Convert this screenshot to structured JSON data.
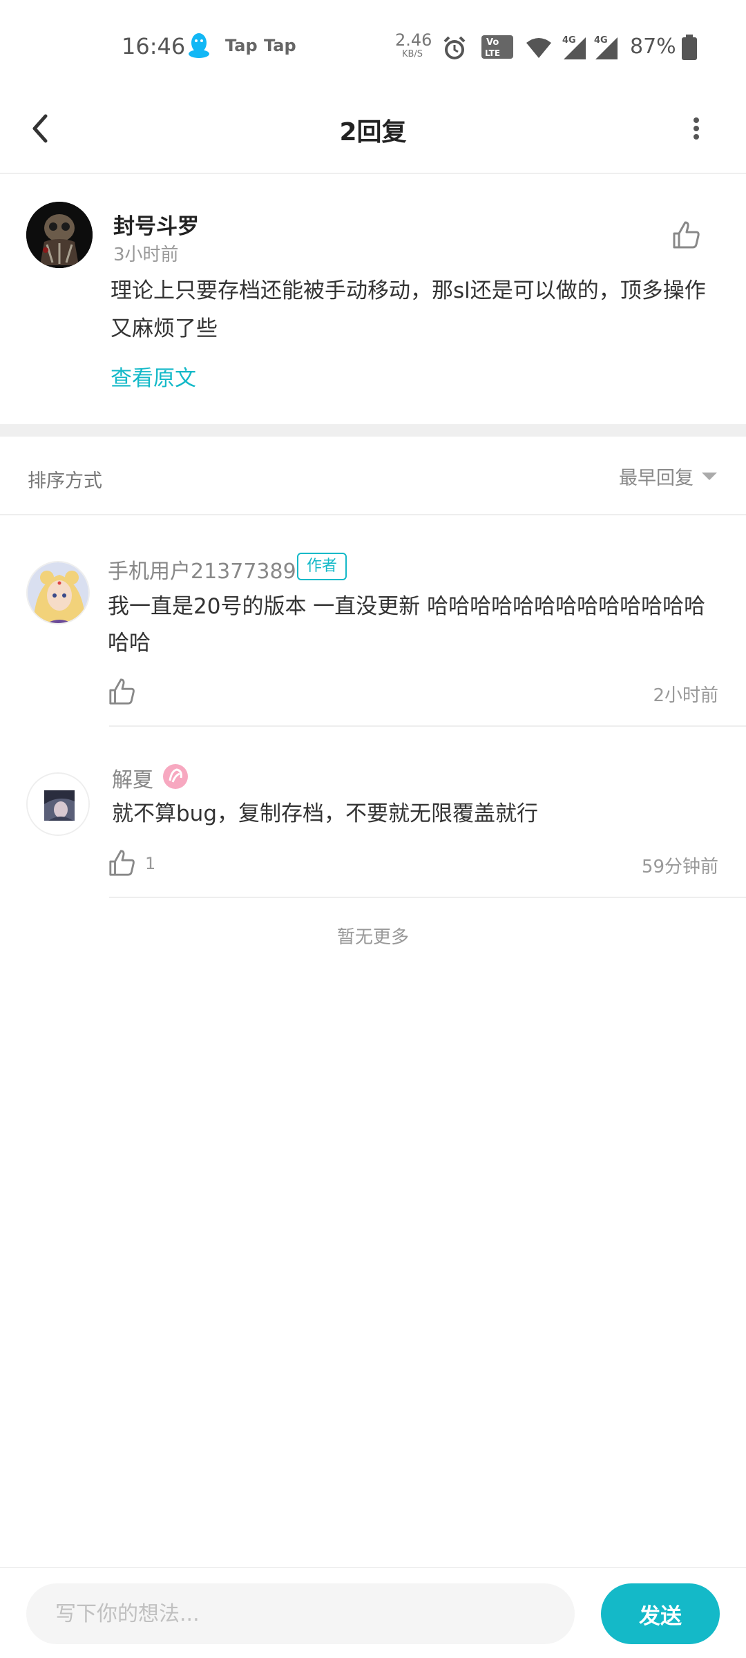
{
  "status_bar": {
    "time": "16:46",
    "app_1": "Tap",
    "app_2": "Tap",
    "net_speed": "2.46",
    "net_unit": "KB/S",
    "volte_top": "Vo",
    "volte_bottom": "LTE",
    "sig_label": "4G",
    "battery": "87%",
    "icons": [
      "qq-icon",
      "alarm-icon",
      "volte-icon",
      "wifi-icon",
      "signal-4g-icon",
      "signal-4g-icon",
      "battery-icon"
    ]
  },
  "nav": {
    "title": "2回复",
    "icons": [
      "back-icon",
      "more-vertical-icon"
    ]
  },
  "original": {
    "author": "封号斗罗",
    "time": "3小时前",
    "content": "理论上只要存档还能被手动移动，那sl还是可以做的，顶多操作又麻烦了些",
    "view_original": "查看原文"
  },
  "sort": {
    "label": "排序方式",
    "selected": "最早回复"
  },
  "replies": [
    {
      "author": "手机用户21377389",
      "badge": "作者",
      "content": "我一直是20号的版本 一直没更新 哈哈哈哈哈哈哈哈哈哈哈哈哈哈哈",
      "like_count": "",
      "time": "2小时前"
    },
    {
      "author": "解夏",
      "content": "就不算bug，复制存档，不要就无限覆盖就行",
      "like_count": "1",
      "time": "59分钟前"
    }
  ],
  "no_more": "暂无更多",
  "composer": {
    "placeholder": "写下你的想法...",
    "value": "",
    "send_label": "发送"
  },
  "colors": {
    "accent": "#14b9c8",
    "text_primary": "#222222",
    "text_secondary": "#999999",
    "divider": "#efefef"
  }
}
